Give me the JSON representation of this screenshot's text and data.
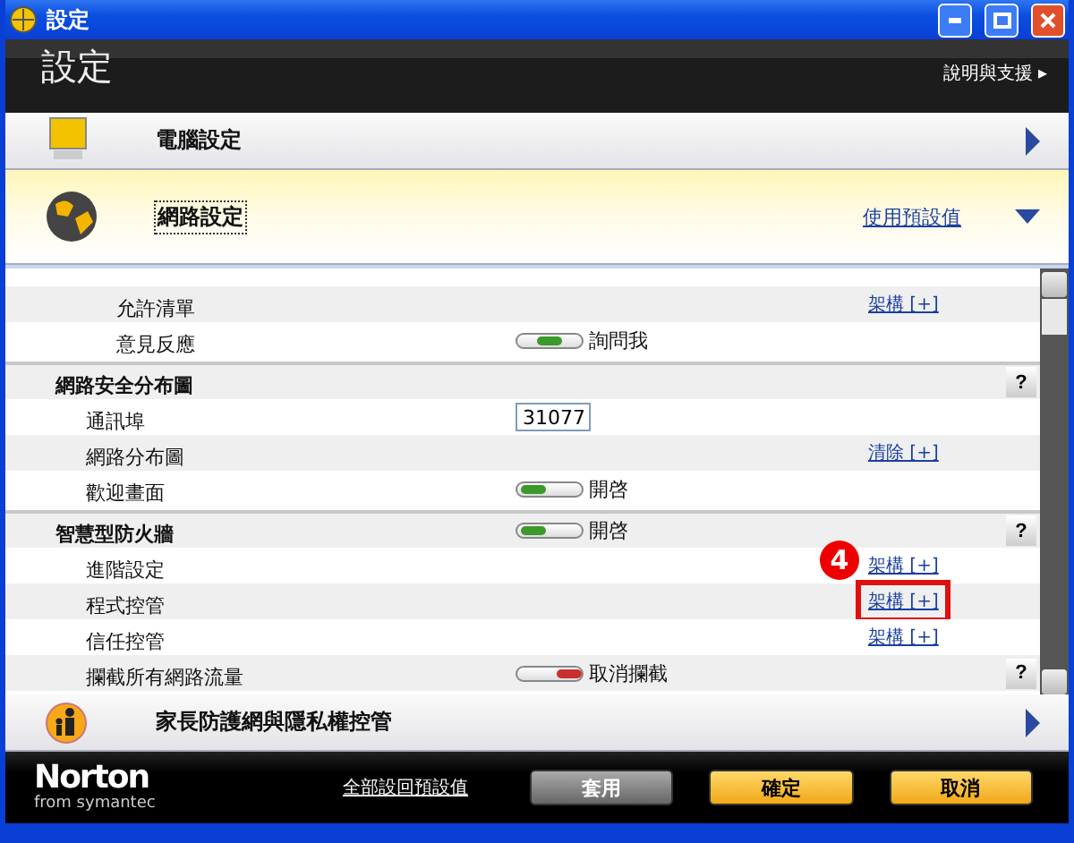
{
  "window": {
    "title": "設定"
  },
  "header": {
    "title": "設定",
    "help_link": "說明與支援",
    "help_arrow": "▸"
  },
  "categories_top": [
    {
      "kind": "monitor",
      "label": "電腦設定",
      "expanded": false
    },
    {
      "kind": "globe",
      "label": "網路設定",
      "expanded": true,
      "action": "使用預設值"
    }
  ],
  "sections": [
    {
      "children": [
        {
          "children": [
            {
              "label": "允許清單",
              "control": {
                "kind": "link",
                "text": "架構 [+]",
                "highlighted": false
              }
            },
            {
              "label": "意見反應",
              "control": {
                "kind": "toggle",
                "on": true,
                "ask": true,
                "text": "詢問我"
              }
            }
          ]
        }
      ]
    },
    {
      "label": "網路安全分布圖",
      "help": true,
      "children": [
        {
          "label": "通訊埠",
          "control": {
            "kind": "field",
            "value": "31077"
          }
        },
        {
          "label": "網路分布圖",
          "control": {
            "kind": "link",
            "text": "清除 [+]",
            "highlighted": false
          }
        },
        {
          "label": "歡迎畫面",
          "control": {
            "kind": "toggle",
            "on": true,
            "text": "開啓"
          }
        }
      ]
    },
    {
      "label": "智慧型防火牆",
      "control": {
        "kind": "toggle",
        "on": true,
        "text": "開啓"
      },
      "help": true,
      "children": [
        {
          "label": "進階設定",
          "control": {
            "kind": "link",
            "text": "架構 [+]",
            "highlighted": false
          },
          "callout": "4"
        },
        {
          "label": "程式控管",
          "control": {
            "kind": "link",
            "text": "架構 [+]",
            "highlighted": true
          }
        },
        {
          "label": "信任控管",
          "control": {
            "kind": "link",
            "text": "架構 [+]",
            "highlighted": false
          }
        },
        {
          "label": "攔截所有網路流量",
          "control": {
            "kind": "toggle",
            "on": false,
            "text": "取消攔截"
          },
          "help": true
        }
      ]
    }
  ],
  "categories_bottom": [
    {
      "kind": "family",
      "label": "家長防護網與隱私權控管",
      "expanded": false
    }
  ],
  "footer": {
    "logo": "Norton",
    "logo_subtitle": "from symantec",
    "reset_link": "全部設回預設值",
    "buttons": [
      {
        "kind": "grey",
        "label": "套用"
      },
      {
        "kind": "gold",
        "label": "確定"
      },
      {
        "kind": "gold",
        "label": "取消"
      }
    ]
  },
  "help_button": "?"
}
